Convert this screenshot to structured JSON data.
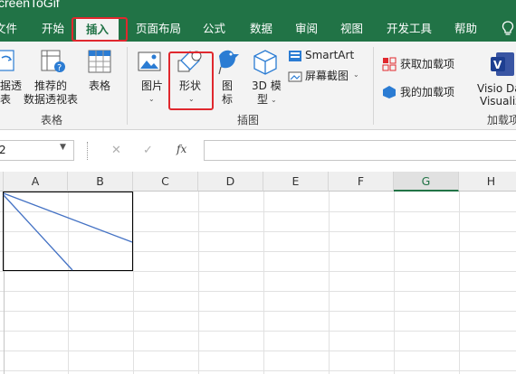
{
  "window": {
    "title": "creenToGif"
  },
  "tabs": [
    {
      "label": "文件"
    },
    {
      "label": "开始"
    },
    {
      "label": "插入"
    },
    {
      "label": "页面布局"
    },
    {
      "label": "公式"
    },
    {
      "label": "数据"
    },
    {
      "label": "审阅"
    },
    {
      "label": "视图"
    },
    {
      "label": "开发工具"
    },
    {
      "label": "帮助"
    }
  ],
  "ribbon": {
    "tables": {
      "pivot_label_1": "据透",
      "pivot_label_2": "表",
      "recommended_pivot_1": "推荐的",
      "recommended_pivot_2": "数据透视表",
      "table_label": "表格",
      "group_label": "表格"
    },
    "illustrations": {
      "picture_label": "图片",
      "shapes_label": "形状",
      "icons_label_1": "图",
      "icons_label_2": "标",
      "model3d_label_1": "3D 模",
      "model3d_label_2": "型",
      "smartart_label": "SmartArt",
      "screenshot_label": "屏幕截图",
      "group_label": "插图"
    },
    "addins": {
      "get_addins_label": "获取加载项",
      "my_addins_label": "我的加载项",
      "visio_label_1": "Visio Da",
      "visio_label_2": "Visualiz",
      "group_label": "加载项"
    }
  },
  "formula_bar": {
    "name_box": "2",
    "fx_symbol": "fx",
    "cancel_symbol": "✕",
    "enter_symbol": "✓"
  },
  "columns": [
    "A",
    "B",
    "C",
    "D",
    "E",
    "F",
    "G",
    "H"
  ],
  "selected_column": "G",
  "colors": {
    "accent": "#217346",
    "highlight": "#e0282e",
    "shape_line": "#4472c4"
  }
}
